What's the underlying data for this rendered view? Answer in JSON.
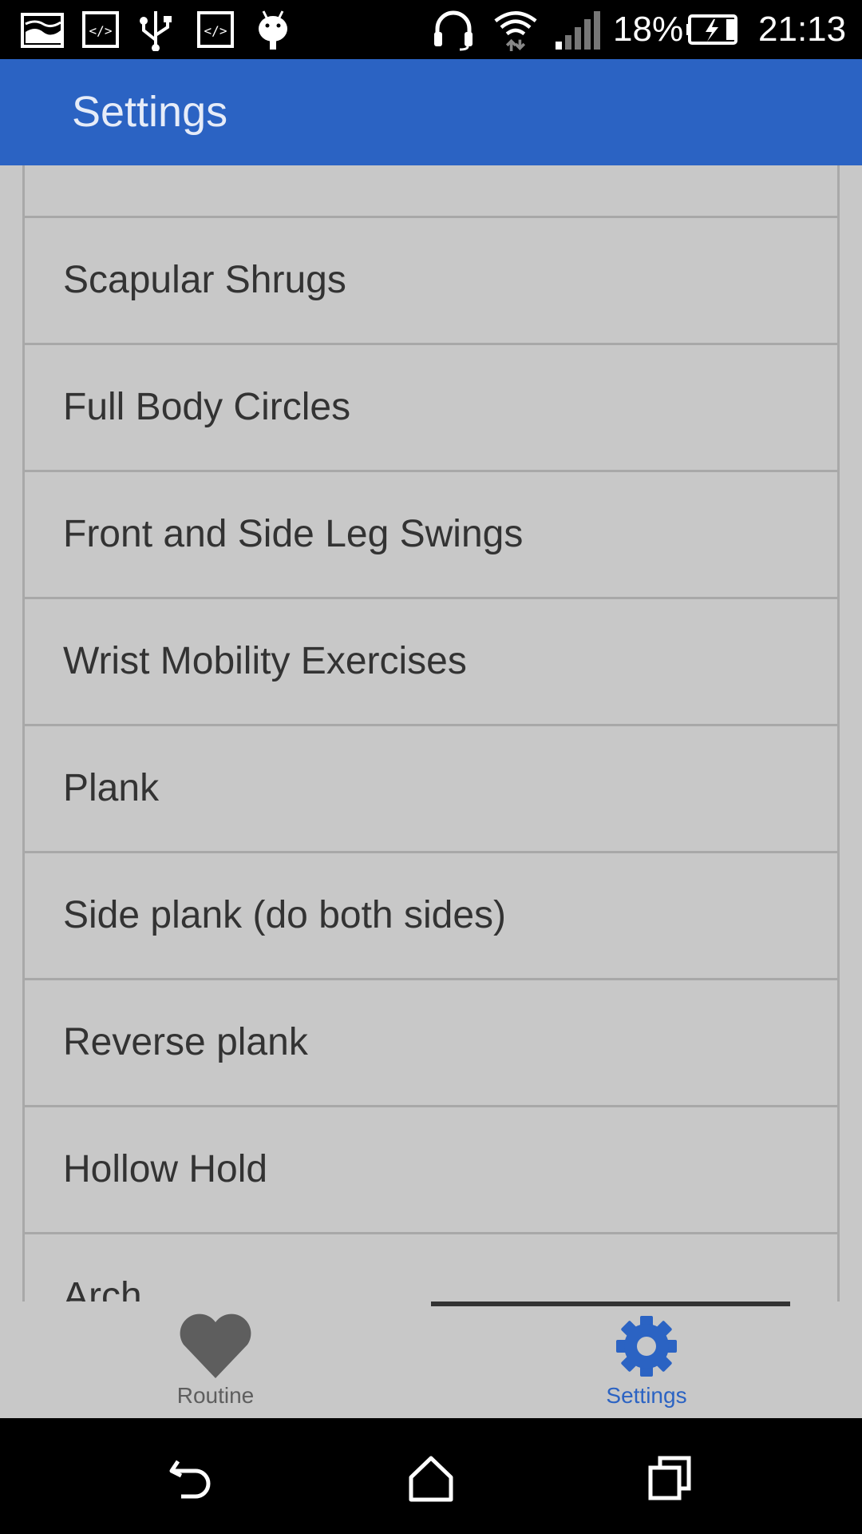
{
  "status_bar": {
    "battery_percent": "18%",
    "time": "21:13",
    "icons": [
      "image-icon",
      "code-icon",
      "usb-icon",
      "code-icon",
      "android-icon",
      "headset-icon",
      "wifi-icon",
      "signal-icon",
      "battery-charging-icon"
    ]
  },
  "app_bar": {
    "title": "Settings"
  },
  "list": {
    "items": [
      {
        "label": ""
      },
      {
        "label": "Scapular Shrugs"
      },
      {
        "label": "Full Body Circles"
      },
      {
        "label": "Front and Side Leg Swings"
      },
      {
        "label": "Wrist Mobility Exercises"
      },
      {
        "label": "Plank"
      },
      {
        "label": "Side plank (do both sides)"
      },
      {
        "label": "Reverse plank"
      },
      {
        "label": "Hollow Hold"
      },
      {
        "label": "Arch"
      }
    ]
  },
  "bottom_nav": {
    "tabs": [
      {
        "label": "Routine",
        "icon": "heart-icon",
        "selected": false
      },
      {
        "label": "Settings",
        "icon": "gear-icon",
        "selected": true
      }
    ]
  },
  "colors": {
    "accent": "#2b63c3",
    "background": "#c8c8c8",
    "text": "#333333"
  }
}
